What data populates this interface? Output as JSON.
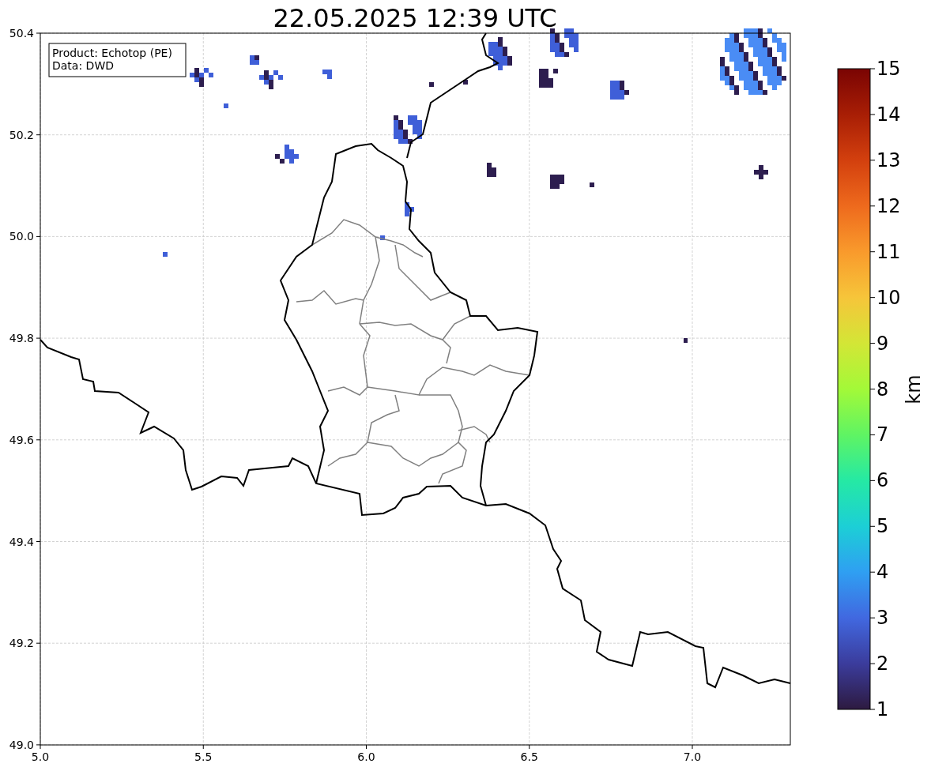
{
  "title": "22.05.2025 12:39 UTC",
  "info_box": [
    "Product: Echotop (PE)",
    "Data: DWD"
  ],
  "x_ticks": [
    "5.0",
    "5.5",
    "6.0",
    "6.5",
    "7.0"
  ],
  "y_ticks": [
    "50.4",
    "50.2",
    "50.0",
    "49.8",
    "49.6",
    "49.4",
    "49.2",
    "49.0"
  ],
  "colorbar": {
    "label": "km",
    "ticks": [
      "15",
      "14",
      "13",
      "12",
      "11",
      "10",
      "9",
      "8",
      "7",
      "6",
      "5",
      "4",
      "3",
      "2",
      "1"
    ]
  }
}
